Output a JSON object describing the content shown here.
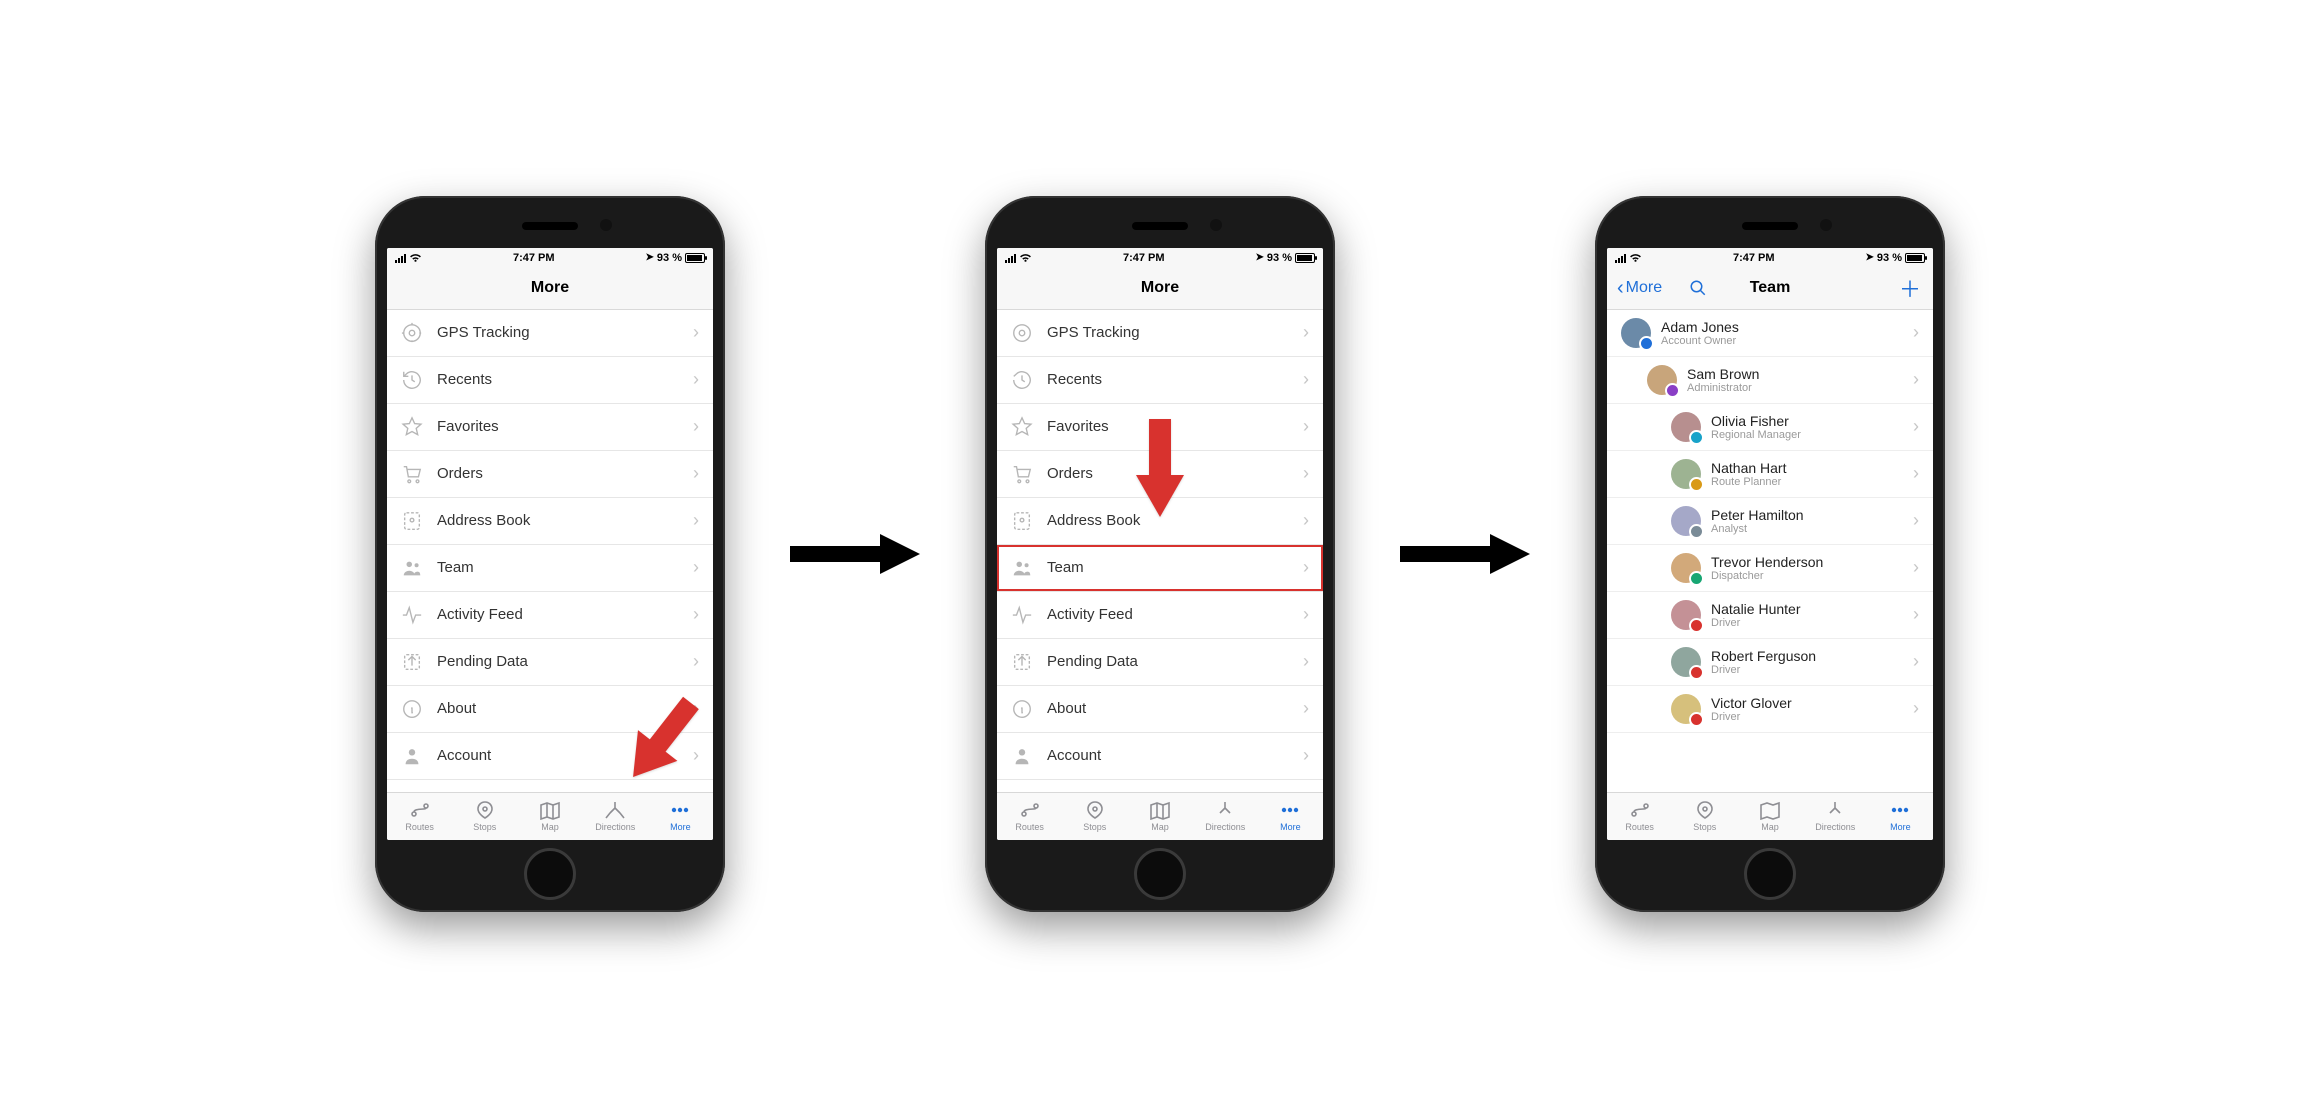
{
  "status": {
    "time": "7:47 PM",
    "battery_pct": "93 %"
  },
  "more_title": "More",
  "menu": {
    "gps": "GPS Tracking",
    "recents": "Recents",
    "favorites": "Favorites",
    "orders": "Orders",
    "address_book": "Address Book",
    "team": "Team",
    "activity_feed": "Activity Feed",
    "pending_data": "Pending Data",
    "about": "About",
    "account": "Account"
  },
  "tabs": {
    "routes": "Routes",
    "stops": "Stops",
    "map": "Map",
    "directions": "Directions",
    "more": "More"
  },
  "team_screen": {
    "back_label": "More",
    "title": "Team",
    "members": [
      {
        "name": "Adam Jones",
        "role": "Account Owner",
        "indent": 0,
        "badge_color": "#1f6fd8"
      },
      {
        "name": "Sam Brown",
        "role": "Administrator",
        "indent": 1,
        "badge_color": "#8a3fc6"
      },
      {
        "name": "Olivia Fisher",
        "role": "Regional Manager",
        "indent": 2,
        "badge_color": "#18a2c9"
      },
      {
        "name": "Nathan Hart",
        "role": "Route Planner",
        "indent": 2,
        "badge_color": "#d99a17"
      },
      {
        "name": "Peter Hamilton",
        "role": "Analyst",
        "indent": 2,
        "badge_color": "#7a8b97"
      },
      {
        "name": "Trevor Henderson",
        "role": "Dispatcher",
        "indent": 2,
        "badge_color": "#17a673"
      },
      {
        "name": "Natalie Hunter",
        "role": "Driver",
        "indent": 2,
        "badge_color": "#d8322e"
      },
      {
        "name": "Robert Ferguson",
        "role": "Driver",
        "indent": 2,
        "badge_color": "#d8322e"
      },
      {
        "name": "Victor Glover",
        "role": "Driver",
        "indent": 2,
        "badge_color": "#d8322e"
      }
    ]
  },
  "colors": {
    "accent": "#1f6fd8",
    "highlight": "#d8322e"
  }
}
